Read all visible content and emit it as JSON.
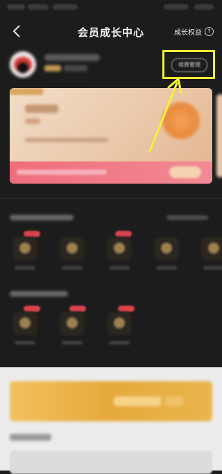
{
  "nav": {
    "title": "会员成长中心",
    "right_label": "成长权益",
    "help_glyph": "?"
  },
  "user": {
    "renew_button": "续费管理"
  },
  "highlight_color": "#f2f238",
  "icons": {
    "back": "chevron-left-icon",
    "help": "question-circle-icon"
  }
}
